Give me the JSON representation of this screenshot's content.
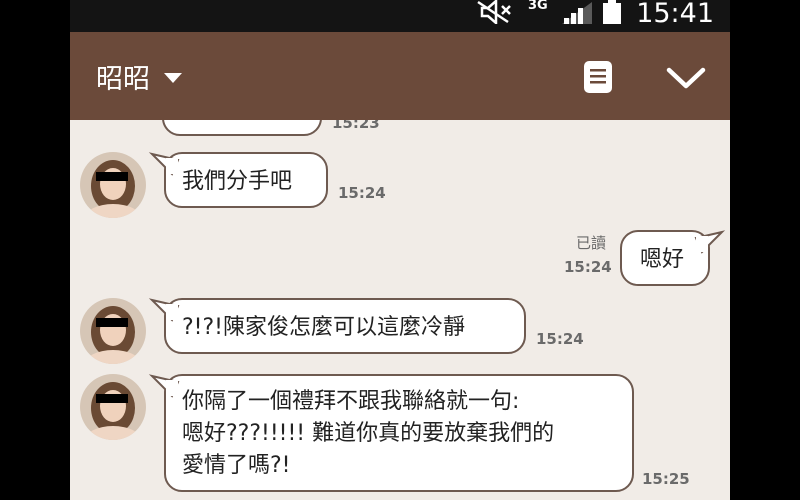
{
  "status_bar": {
    "network": "3G",
    "time": "15:41"
  },
  "header": {
    "title": "昭昭"
  },
  "messages": [
    {
      "time": "15:23"
    },
    {
      "text": "我們分手吧",
      "time": "15:24"
    },
    {
      "read_label": "已讀",
      "text": "嗯好",
      "time": "15:24"
    },
    {
      "text": "?!?!陳家俊怎麼可以這麼冷靜",
      "time": "15:24"
    },
    {
      "lines": [
        "你隔了一個禮拜不跟我聯絡就一句:",
        "嗯好???!!!!! 難道你真的要放棄我們的",
        "愛情了嗎?!"
      ],
      "time": "15:25"
    }
  ],
  "colors": {
    "header_bg": "#6b4a3a",
    "chat_bg": "#f1ece7",
    "bubble_border": "#6e5a50",
    "status_bg": "#141414"
  },
  "icons": [
    "mute-icon",
    "signal-icon",
    "battery-icon",
    "dropdown-icon",
    "notes-icon",
    "chevron-down-icon"
  ]
}
